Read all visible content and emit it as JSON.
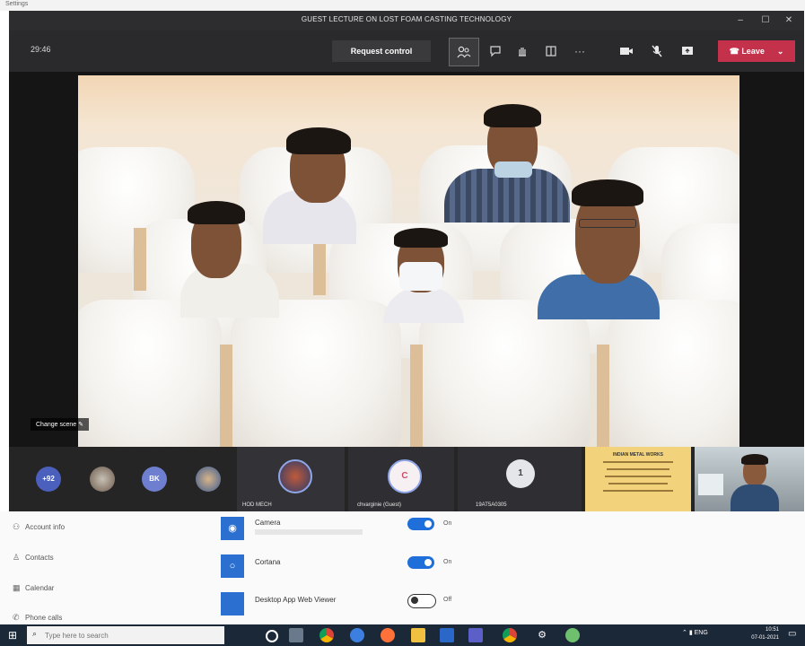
{
  "top_strip": {
    "label": "Settings"
  },
  "window": {
    "title": "GUEST LECTURE ON LOST FOAM CASTING TECHNOLOGY",
    "controls": [
      "–",
      "☐",
      "✕"
    ]
  },
  "toolbar": {
    "timer": "29:46",
    "request_control": "Request control",
    "leave_label": "Leave"
  },
  "stage": {
    "change_scene": "Change scene"
  },
  "participants": {
    "overflow_badge": "+92",
    "bk_initials": "BK",
    "tiles": [
      {
        "name": "HOD MECH"
      },
      {
        "name": "chvarginie (Guest)",
        "initial": "C"
      },
      {
        "name": "19AT5A0305",
        "initial": "1"
      }
    ],
    "slide_title": "INDIAN METAL WORKS"
  },
  "settings": {
    "nav": [
      {
        "label": "Account info",
        "icon": "user-icon"
      },
      {
        "label": "Contacts",
        "icon": "contacts-icon"
      },
      {
        "label": "Calendar",
        "icon": "calendar-icon"
      },
      {
        "label": "Phone calls",
        "icon": "phone-icon"
      }
    ],
    "items": [
      {
        "label": "Camera",
        "state": "On"
      },
      {
        "label": "Cortana",
        "state": "On"
      },
      {
        "label": "Desktop App Web Viewer",
        "state": "Off"
      }
    ]
  },
  "taskbar": {
    "search_placeholder": "Type here to search",
    "lang": "ENG",
    "time": "10:51",
    "date": "07-01-2021"
  },
  "colors": {
    "leave": "#c4314b",
    "toggle_on": "#1e6fd9",
    "accent": "#2b6fd1"
  }
}
